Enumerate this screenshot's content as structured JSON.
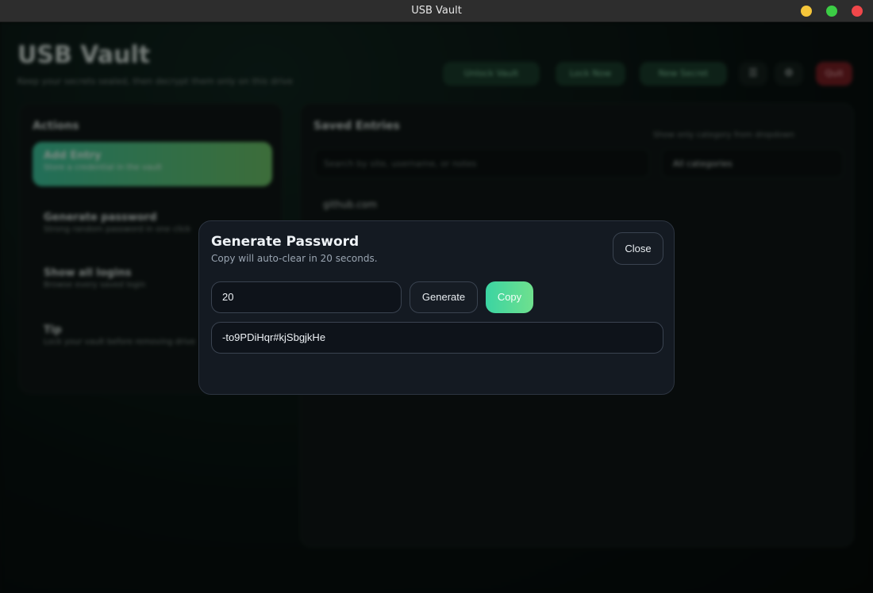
{
  "window": {
    "title": "USB Vault"
  },
  "app": {
    "title": "USB Vault",
    "subtitle": "Keep your secrets sealed, then decrypt them only on this drive",
    "header_buttons": [
      "Unlock Vault",
      "Lock Now",
      "New Secret",
      "☰",
      "⚙",
      "Quit"
    ]
  },
  "actions_panel": {
    "heading": "Actions",
    "items": [
      {
        "label": "Add Entry",
        "sub": "Store a credential in the vault"
      },
      {
        "label": "Generate password",
        "sub": "Strong random password in one click"
      },
      {
        "label": "Show all logins",
        "sub": "Browse every saved login"
      },
      {
        "label": "Tip",
        "sub": "Lock your vault before removing drive"
      }
    ]
  },
  "entries_panel": {
    "heading": "Saved Entries",
    "search_placeholder": "Search by site, username, or notes",
    "filter_label": "Show only category from dropdown",
    "filter_value": "All categories",
    "first_entry": "github.com"
  },
  "modal": {
    "title": "Generate Password",
    "subtitle": "Copy will auto-clear in 20 seconds.",
    "close_label": "Close",
    "length_value": "20",
    "generate_label": "Generate",
    "copy_label": "Copy",
    "password_value": "-to9PDiHqr#kjSbgjkHe"
  },
  "colors": {
    "accent_start": "#3bd4a2",
    "accent_end": "#6fe08e"
  }
}
